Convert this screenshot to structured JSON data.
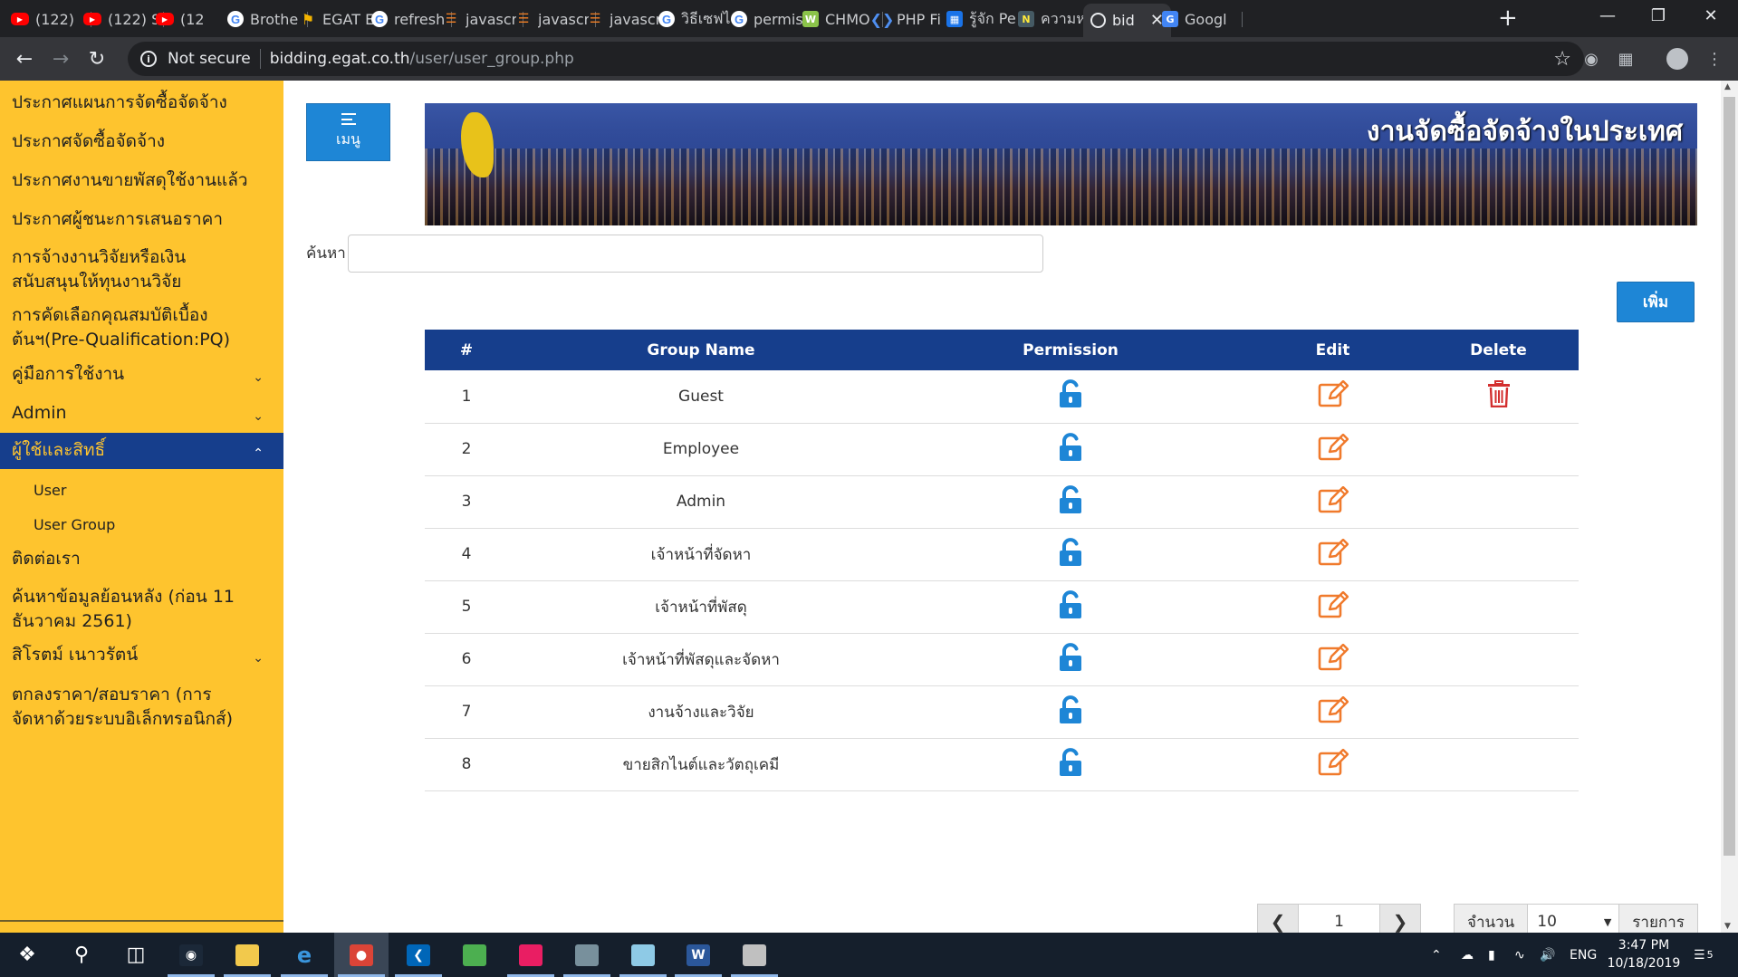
{
  "browser": {
    "tabs": [
      {
        "title": "(122)",
        "icon": "youtube-icon"
      },
      {
        "title": "(122) S",
        "icon": "youtube-icon"
      },
      {
        "title": "(12",
        "icon": "youtube-icon"
      },
      {
        "title": "Brothe",
        "icon": "google-icon"
      },
      {
        "title": "EGAT E",
        "icon": "egat-icon"
      },
      {
        "title": "refresh",
        "icon": "google-icon"
      },
      {
        "title": "javascr",
        "icon": "stackoverflow-icon"
      },
      {
        "title": "javascr",
        "icon": "stackoverflow-icon"
      },
      {
        "title": "javascr",
        "icon": "stackoverflow-icon"
      },
      {
        "title": "วิธีเซฟไ",
        "icon": "google-icon"
      },
      {
        "title": "permis",
        "icon": "google-icon"
      },
      {
        "title": "CHMO",
        "icon": "chmod-icon"
      },
      {
        "title": "PHP Fi",
        "icon": "php-icon"
      },
      {
        "title": "รู้จัก Pe",
        "icon": "network-icon"
      },
      {
        "title": "ความห",
        "icon": "news-icon"
      },
      {
        "title": "bid",
        "icon": "globe-icon",
        "active": true
      },
      {
        "title": "Googl",
        "icon": "google-translate-icon"
      }
    ],
    "address": {
      "security": "Not secure",
      "host": "bidding.egat.co.th",
      "path": "/user/user_group.php"
    }
  },
  "sidebar": {
    "items": [
      {
        "label": "ประกาศแผนการจัดซื้อจัดจ้าง"
      },
      {
        "label": "ประกาศจัดซื้อจัดจ้าง"
      },
      {
        "label": "ประกาศงานขายพัสดุใช้งานแล้ว"
      },
      {
        "label": "ประกาศผู้ชนะการเสนอราคา"
      },
      {
        "label": "การจ้างงานวิจัยหรือเงินสนับสนุนให้ทุนงานวิจัย"
      },
      {
        "label": "การคัดเลือกคุณสมบัติเบื้องต้นฯ(Pre-Qualification:PQ)"
      },
      {
        "label": "คู่มือการใช้งาน",
        "chevron": "down"
      },
      {
        "label": "Admin",
        "chevron": "down"
      },
      {
        "label": "ผู้ใช้และสิทธิ์",
        "chevron": "up",
        "active": true
      },
      {
        "label": "User",
        "sub": true
      },
      {
        "label": "User Group",
        "sub": true
      },
      {
        "label": "ติดต่อเรา"
      },
      {
        "label": "ค้นหาข้อมูลย้อนหลัง (ก่อน 11 ธันวาคม 2561)"
      },
      {
        "label": "สิโรตม์ เนาวรัตน์",
        "chevron": "down"
      },
      {
        "label": "ตกลงราคา/สอบราคา (การจัดหาด้วยระบบอิเล็กทรอนิกส์)"
      }
    ]
  },
  "header": {
    "menu_label": "เมนู",
    "banner_title": "งานจัดซื้อจัดจ้างในประเทศ"
  },
  "search": {
    "label": "ค้นหา",
    "value": "",
    "placeholder": ""
  },
  "add_button": "เพิ่ม",
  "table": {
    "columns": [
      "#",
      "Group Name",
      "Permission",
      "Edit",
      "Delete"
    ],
    "rows": [
      {
        "num": "1",
        "name": "Guest",
        "deletable": true
      },
      {
        "num": "2",
        "name": "Employee",
        "deletable": false
      },
      {
        "num": "3",
        "name": "Admin",
        "deletable": false
      },
      {
        "num": "4",
        "name": "เจ้าหน้าที่จัดหา",
        "deletable": false
      },
      {
        "num": "5",
        "name": "เจ้าหน้าที่พัสดุ",
        "deletable": false
      },
      {
        "num": "6",
        "name": "เจ้าหน้าที่พัสดุและจัดหา",
        "deletable": false
      },
      {
        "num": "7",
        "name": "งานจ้างและวิจัย",
        "deletable": false
      },
      {
        "num": "8",
        "name": "ขายสิกไนต์และวัตถุเคมี",
        "deletable": false
      }
    ]
  },
  "pagination": {
    "page": "1",
    "count_label": "จำนวน",
    "per_page": "10",
    "unit_label": "รายการ"
  },
  "taskbar": {
    "apps": [
      "start-icon",
      "search-icon",
      "task-view-icon",
      "steam-icon",
      "file-explorer-icon",
      "edge-icon",
      "chrome-icon",
      "vscode-icon",
      "app-icon",
      "app-icon",
      "app-icon",
      "app-icon",
      "word-icon",
      "paint-icon"
    ],
    "language": "ENG",
    "time": "3:47 PM",
    "date": "10/18/2019",
    "notifications": "5"
  },
  "colors": {
    "sidebar_bg": "#fec42e",
    "nav_blue": "#163e8c",
    "button_blue": "#1e86d6",
    "permission_icon": "#1e86d6",
    "edit_icon": "#f07a2c",
    "delete_icon": "#d32f2f"
  }
}
